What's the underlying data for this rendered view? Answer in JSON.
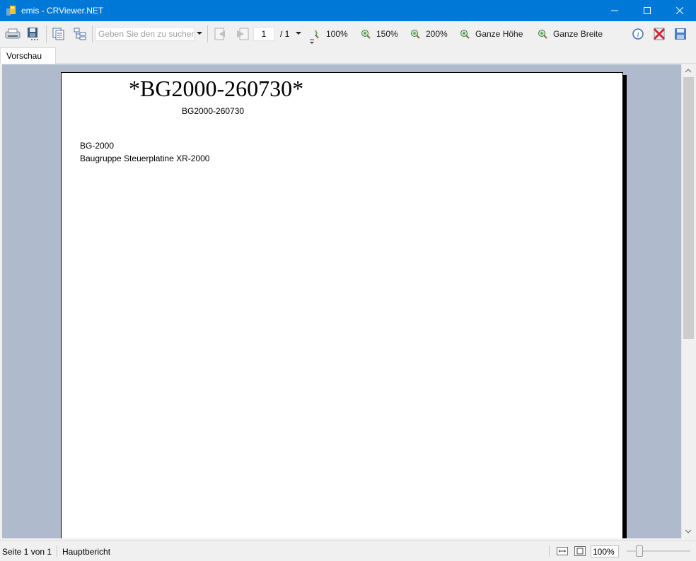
{
  "window": {
    "title": "emis - CRViewer.NET",
    "accent": "#0078d7",
    "controls": [
      "minimize-icon",
      "maximize-icon",
      "close-icon"
    ]
  },
  "toolbar": {
    "search_placeholder": "Geben Sie den zu suchen",
    "page_current": "1",
    "page_total": "/ 1",
    "zoom_buttons": [
      "100%",
      "150%",
      "200%",
      "Ganze Höhe",
      "Ganze Breite"
    ]
  },
  "tabs": [
    {
      "label": "Vorschau",
      "active": true
    }
  ],
  "report": {
    "barcode": "*BG2000-260730*",
    "barcode_text": "BG2000-260730",
    "item_code": "BG-2000",
    "item_description": "Baugruppe Steuerplatine XR-2000"
  },
  "statusbar": {
    "page_info": "Seite 1 von 1",
    "report_name": "Hauptbericht",
    "zoom": "100%"
  }
}
